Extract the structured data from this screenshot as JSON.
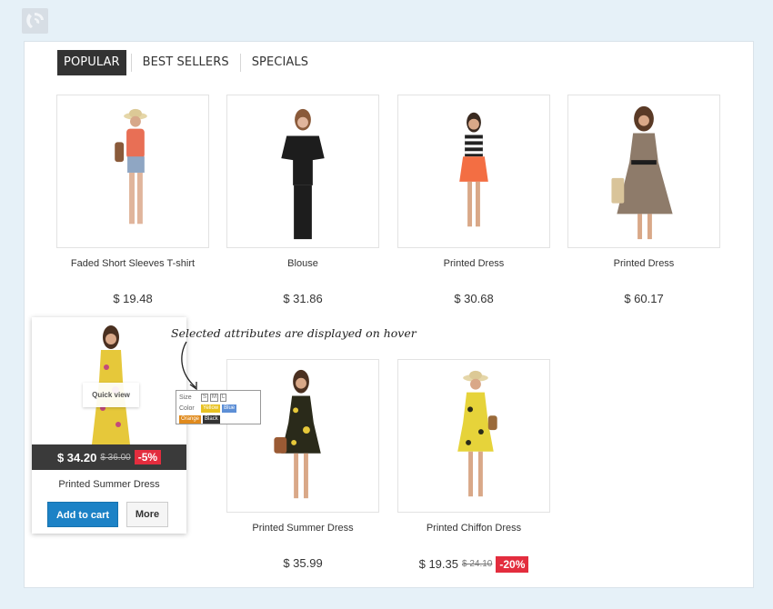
{
  "tabs": [
    {
      "label": "POPULAR",
      "active": true
    },
    {
      "label": "BEST SELLERS",
      "active": false
    },
    {
      "label": "SPECIALS",
      "active": false
    }
  ],
  "products": [
    {
      "name": "Faded Short Sleeves T-shirt",
      "price": "$ 19.48"
    },
    {
      "name": "Blouse",
      "price": "$ 31.86"
    },
    {
      "name": "Printed Dress",
      "price": "$ 30.68"
    },
    {
      "name": "Printed Dress",
      "price": "$ 60.17"
    },
    {
      "name": "Printed Summer Dress",
      "price": "$ 34.20",
      "old_price": "$ 36.00",
      "discount": "-5%"
    },
    {
      "name": "Printed Summer Dress",
      "price": "$ 35.99"
    },
    {
      "name": "Printed Chiffon Dress",
      "price": "$ 19.35",
      "old_price": "$ 24.10",
      "discount": "-20%"
    }
  ],
  "hover": {
    "quick_view": "Quick view",
    "add_to_cart": "Add to cart",
    "more": "More"
  },
  "attributes": {
    "size_label": "Size",
    "sizes": [
      "S",
      "M",
      "L"
    ],
    "color_label": "Color",
    "colors": [
      {
        "name": "Yellow",
        "hex": "#e8c222"
      },
      {
        "name": "Blue",
        "hex": "#5d8fd6"
      },
      {
        "name": "Orange",
        "hex": "#e08a1c"
      },
      {
        "name": "Black",
        "hex": "#333333"
      }
    ]
  },
  "annotation": "Selected attributes are displayed on hover",
  "colors": {
    "accent": "#1c82c6",
    "discount": "#e32d3e",
    "dark": "#333333"
  }
}
